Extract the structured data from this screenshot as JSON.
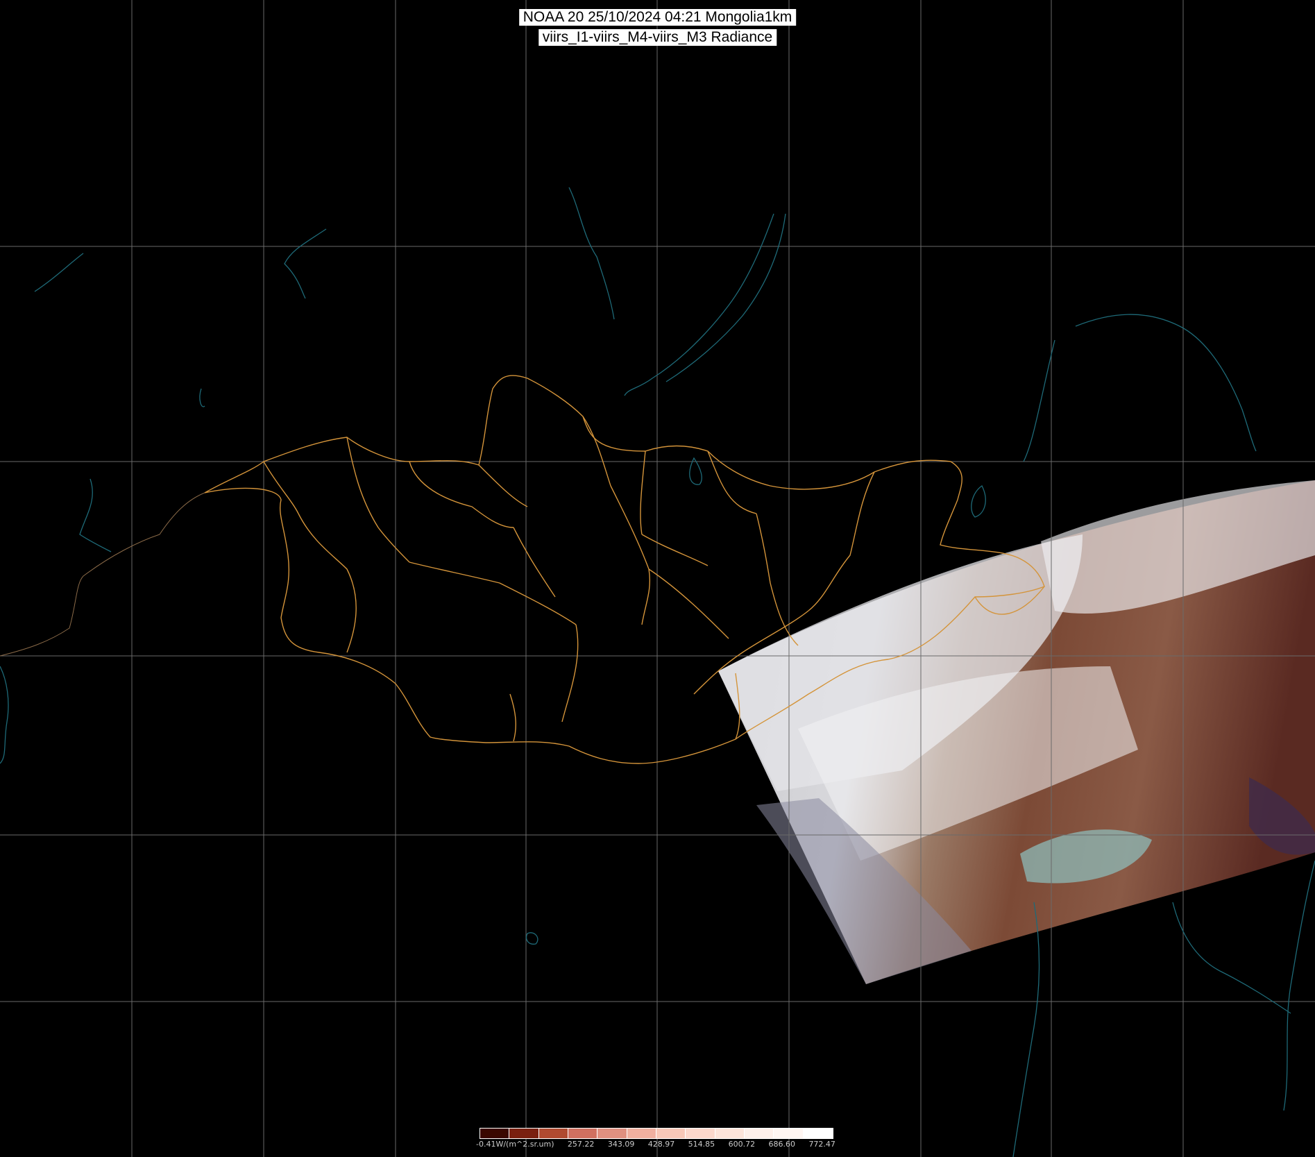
{
  "title": {
    "line1": "NOAA 20 25/10/2024 04:21 Mongolia1km",
    "line2": "viirs_I1-viirs_M4-viirs_M3 Radiance"
  },
  "legend": {
    "labels": [
      "-0.41W/(m^2.sr.um)",
      "257.22",
      "343.09",
      "428.97",
      "514.85",
      "600.72",
      "686.60",
      "772.47"
    ],
    "colors": [
      "#3a0800",
      "#7a2010",
      "#b04a30",
      "#d07060",
      "#e09080",
      "#f0b0a0",
      "#f8c8b8",
      "#fcd8cc",
      "#fde4da",
      "#fef0ea",
      "#fff6f2",
      "#ffffff"
    ]
  },
  "colors": {
    "background": "#000000",
    "gridlines": "#6a6a6a",
    "borders": "#d4943a",
    "coastlines": "#1e6a78"
  }
}
